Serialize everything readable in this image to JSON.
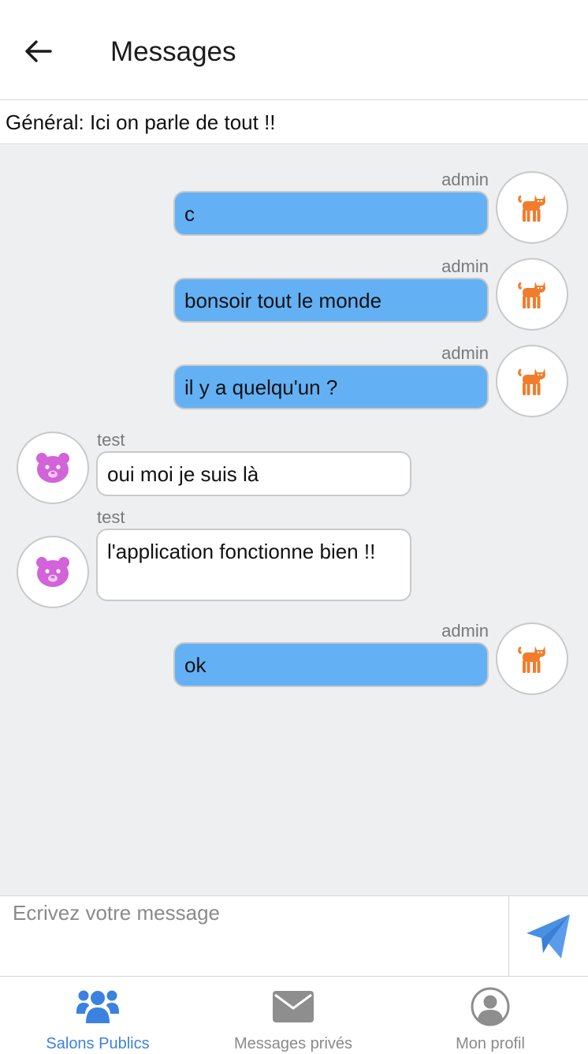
{
  "header": {
    "title": "Messages"
  },
  "room": {
    "description": "Général: Ici on parle de tout !!"
  },
  "messages": [
    {
      "sender": "admin",
      "text": "c"
    },
    {
      "sender": "admin",
      "text": "bonsoir tout le monde"
    },
    {
      "sender": "admin",
      "text": "il y a quelqu'un ?"
    },
    {
      "sender": "test",
      "text": "oui moi je suis là"
    },
    {
      "sender": "test",
      "text": "l'application fonctionne bien !!"
    },
    {
      "sender": "admin",
      "text": "ok"
    }
  ],
  "composer": {
    "placeholder": "Ecrivez votre message"
  },
  "tabs": [
    {
      "label": "Salons Publics",
      "icon": "users-icon",
      "active": true
    },
    {
      "label": "Messages privés",
      "icon": "envelope-icon",
      "active": false
    },
    {
      "label": "Mon profil",
      "icon": "user-circle-icon",
      "active": false
    }
  ],
  "colors": {
    "accent": "#3b82e0",
    "my_bubble": "#63b1f4",
    "chat_background": "#eeeff1",
    "cat_avatar": "#f07d2c",
    "bear_avatar": "#d263d9"
  },
  "avatars": {
    "admin": "cat-icon",
    "test": "bear-icon"
  }
}
